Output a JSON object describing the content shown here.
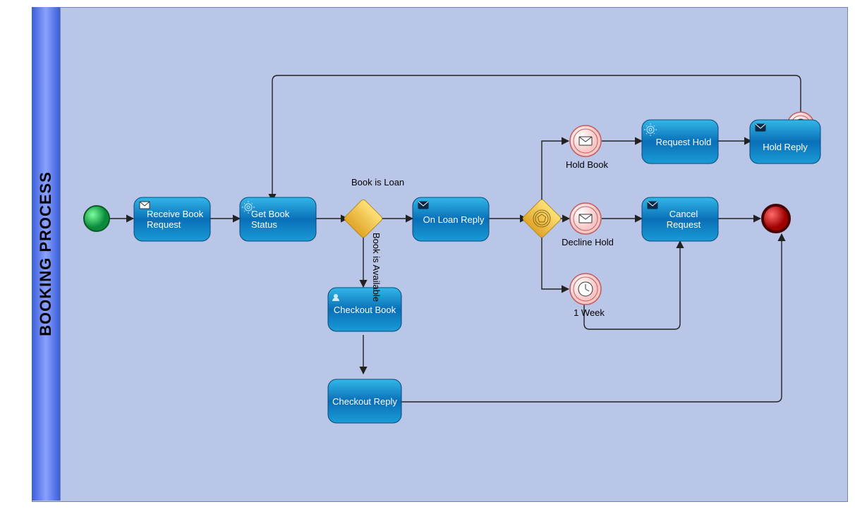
{
  "lane_title": "BOOKING PROCESS",
  "tasks": {
    "receive": "Receive Book Request",
    "getstatus": "Get Book Status",
    "loanreply": "On Loan Reply",
    "checkoutbook": "Checkout Book",
    "checkoutreply": "Checkout Reply",
    "requesthold": "Request Hold",
    "cancelrequest": "Cancel Request",
    "holdreply": "Hold Reply"
  },
  "labels": {
    "bookisloan": "Book is Loan",
    "bookisavailable": "Book is Available",
    "holdbook": "Hold Book",
    "declinehold": "Decline Hold",
    "oneweek": "1 Week"
  },
  "chart_data": {
    "type": "bpmn",
    "pool": "BOOKING PROCESS",
    "elements": [
      {
        "id": "start",
        "type": "startEvent"
      },
      {
        "id": "receive",
        "type": "receiveTask",
        "label": "Receive Book Request"
      },
      {
        "id": "getstatus",
        "type": "serviceTask",
        "label": "Get Book Status"
      },
      {
        "id": "gw1",
        "type": "exclusiveGateway"
      },
      {
        "id": "loanreply",
        "type": "sendTask",
        "label": "On Loan Reply"
      },
      {
        "id": "checkoutbook",
        "type": "userTask",
        "label": "Checkout Book"
      },
      {
        "id": "checkoutreply",
        "type": "task",
        "label": "Checkout Reply"
      },
      {
        "id": "gw2",
        "type": "eventBasedGateway"
      },
      {
        "id": "evHold",
        "type": "intermediateCatchEvent",
        "subtype": "message",
        "label": "Hold Book"
      },
      {
        "id": "evDecline",
        "type": "intermediateCatchEvent",
        "subtype": "message",
        "label": "Decline Hold"
      },
      {
        "id": "evWeek",
        "type": "intermediateCatchEvent",
        "subtype": "timer",
        "label": "1 Week"
      },
      {
        "id": "requesthold",
        "type": "serviceTask",
        "label": "Request Hold"
      },
      {
        "id": "cancelrequest",
        "type": "sendTask",
        "label": "Cancel Request"
      },
      {
        "id": "holdreply",
        "type": "sendTask",
        "label": "Hold Reply",
        "boundary": "timer"
      },
      {
        "id": "end",
        "type": "endEvent"
      }
    ],
    "flows": [
      {
        "from": "start",
        "to": "receive"
      },
      {
        "from": "receive",
        "to": "getstatus"
      },
      {
        "from": "getstatus",
        "to": "gw1"
      },
      {
        "from": "gw1",
        "to": "loanreply",
        "label": "Book is Loan"
      },
      {
        "from": "gw1",
        "to": "checkoutbook",
        "label": "Book is Available"
      },
      {
        "from": "checkoutbook",
        "to": "checkoutreply"
      },
      {
        "from": "checkoutreply",
        "to": "end"
      },
      {
        "from": "loanreply",
        "to": "gw2"
      },
      {
        "from": "gw2",
        "to": "evHold"
      },
      {
        "from": "gw2",
        "to": "evDecline"
      },
      {
        "from": "gw2",
        "to": "evWeek"
      },
      {
        "from": "evHold",
        "to": "requesthold"
      },
      {
        "from": "evDecline",
        "to": "cancelrequest"
      },
      {
        "from": "evWeek",
        "to": "cancelrequest"
      },
      {
        "from": "requesthold",
        "to": "holdreply"
      },
      {
        "from": "cancelrequest",
        "to": "end"
      },
      {
        "from": "holdreply",
        "to": "getstatus",
        "via": "boundary-timer"
      }
    ]
  }
}
